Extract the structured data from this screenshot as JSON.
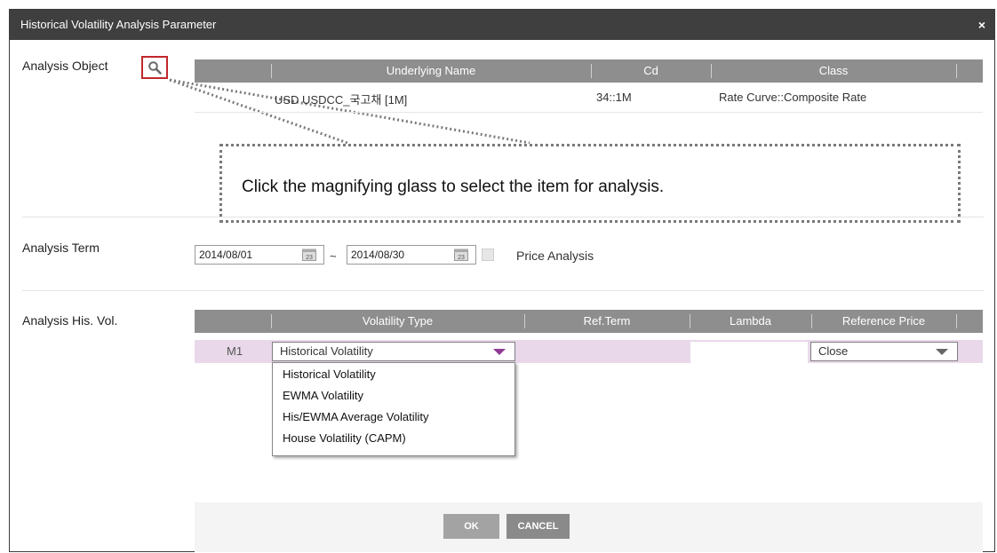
{
  "window": {
    "title": "Historical Volatility Analysis Parameter",
    "close_glyph": "×"
  },
  "analysis_object": {
    "label": "Analysis Object",
    "columns": [
      "Underlying Name",
      "Cd",
      "Class"
    ],
    "rows": [
      {
        "name": "USD USDCC_국고채 [1M]",
        "cd": "34::1M",
        "class": "Rate Curve::Composite Rate"
      }
    ],
    "search_icon": "magnifier-icon",
    "highlight_color": "#c0282d"
  },
  "callout": {
    "text": "Click the magnifying glass to select the item for analysis."
  },
  "analysis_term": {
    "label": "Analysis Term",
    "start_date": "2014/08/01",
    "separator": "~",
    "end_date": "2014/08/30",
    "calendar_icon_text": "23",
    "price_analysis_label": "Price Analysis",
    "price_analysis_checked": false
  },
  "his_vol": {
    "label": "Analysis His. Vol.",
    "columns": [
      "Volatility Type",
      "Ref.Term",
      "Lambda",
      "Reference Price"
    ],
    "row": {
      "id": "M1",
      "volatility_type": "Historical Volatility",
      "ref_term": "",
      "lambda": "",
      "reference_price": "Close"
    },
    "dropdown_options": [
      "Historical Volatility",
      "EWMA Volatility",
      "His/EWMA Average Volatility",
      "House Volatility (CAPM)"
    ],
    "row_color": "#e8d8ea",
    "dropdown_arrow_color": "#8e3a93"
  },
  "buttons": {
    "ok": "OK",
    "cancel": "CANCEL"
  }
}
